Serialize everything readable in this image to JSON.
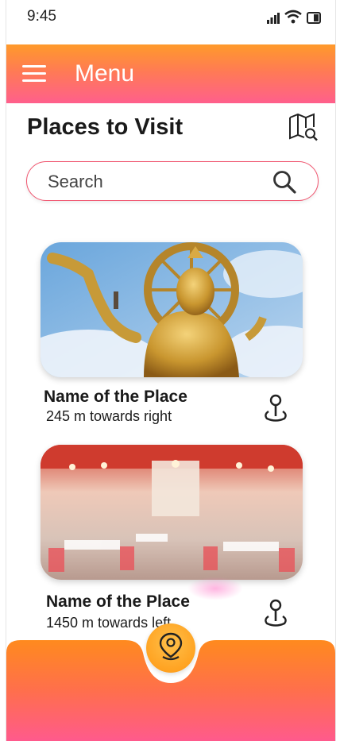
{
  "status_bar": {
    "time": "9:45"
  },
  "header": {
    "title": "Menu"
  },
  "page": {
    "title": "Places to Visit"
  },
  "search": {
    "placeholder": "Search",
    "value": ""
  },
  "places": [
    {
      "name": "Name of the Place",
      "distance": "245 m towards right"
    },
    {
      "name": "Name of the Place",
      "distance": "1450 m towards left"
    }
  ],
  "icons": {
    "menu": "hamburger-icon",
    "map_search": "map-search-icon",
    "search": "search-icon",
    "locate": "location-pin-icon",
    "fab": "location-pin-icon"
  },
  "colors": {
    "header_top": "#ff9a2a",
    "header_bottom": "#ff5f8c",
    "search_border": "#f0556f",
    "fab": "#ffa322"
  }
}
